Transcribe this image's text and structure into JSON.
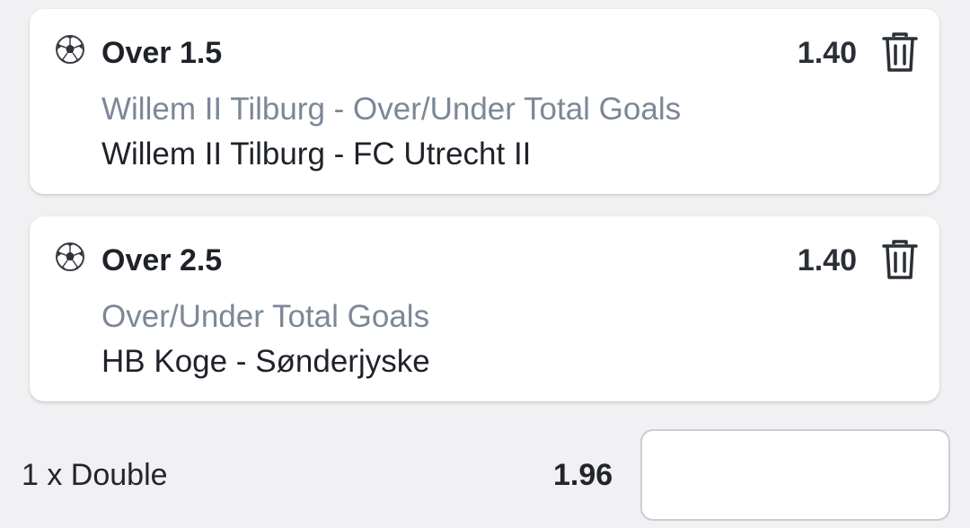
{
  "bets": [
    {
      "sport_icon": "soccer-ball-icon",
      "selection": "Over 1.5",
      "odds": "1.40",
      "market": "Willem II Tilburg - Over/Under Total Goals",
      "event": "Willem II Tilburg - FC Utrecht II",
      "remove_icon": "trash-icon"
    },
    {
      "sport_icon": "soccer-ball-icon",
      "selection": "Over 2.5",
      "odds": "1.40",
      "market": "Over/Under Total Goals",
      "event": "HB Koge - Sønderjyske",
      "remove_icon": "trash-icon"
    }
  ],
  "summary": {
    "label": "1 x Double",
    "odds": "1.96",
    "stake_value": ""
  },
  "colors": {
    "background": "#f1f1f3",
    "card": "#ffffff",
    "muted_text": "#7c8797",
    "primary_text": "#1f2229"
  }
}
